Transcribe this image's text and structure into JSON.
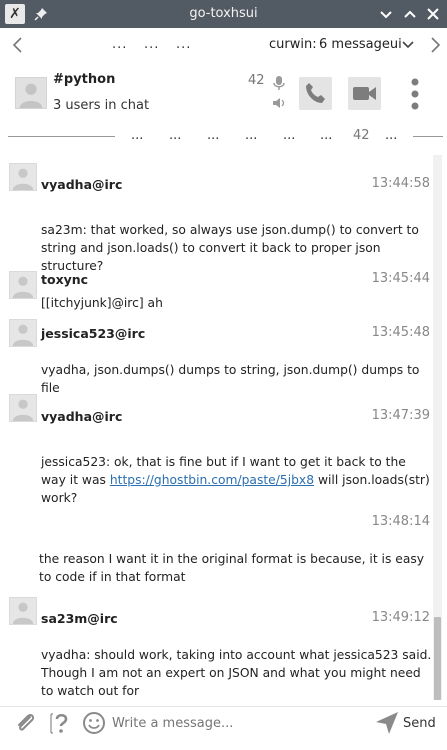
{
  "window": {
    "title": "go-toxhsui"
  },
  "topnav": {
    "left_dots": [
      "...",
      "...",
      "..."
    ],
    "profile_name": "curwin:",
    "message_count_label": "6 messageui"
  },
  "chat": {
    "name": "#python",
    "users_label": "3 users in chat",
    "count": "42"
  },
  "pager": {
    "dots": [
      "...",
      "...",
      "...",
      "...",
      "...",
      "...",
      "..."
    ],
    "number": "42"
  },
  "messages": [
    {
      "author": "vyadha@irc",
      "time": "13:44:58",
      "text": "sa23m: that worked, so always use json.dump() to convert to string and json.loads() to convert it back to proper json structure?"
    },
    {
      "author": "toxync",
      "time": "13:45:44",
      "text": "[[itchyjunk]@irc] ah"
    },
    {
      "author": "jessica523@irc",
      "time": "13:45:48",
      "text": "vyadha, json.dumps() dumps to string, json.dump() dumps to file"
    },
    {
      "author": "vyadha@irc",
      "time": "13:47:39",
      "text_before": "jessica523: ok, that is fine but if I want to get it back to the way it was ",
      "link": "https://ghostbin.com/paste/5jbx8",
      "text_after": " will json.loads(str) work?"
    },
    {
      "author": "",
      "time": "13:48:14",
      "text": "the reason I want it in the original format is because, it is easy to code if in that format"
    },
    {
      "author": "sa23m@irc",
      "time": "13:49:12",
      "text": "vyadha: should work, taking into account what jessica523 said. Though I am not an expert on JSON and what you might need to watch out for"
    }
  ],
  "composer": {
    "placeholder": "Write a message...",
    "send_label": "Send"
  },
  "colors": {
    "titlebar": "#525a63",
    "link": "#2a6fb0",
    "icon": "#8a8a8a"
  }
}
